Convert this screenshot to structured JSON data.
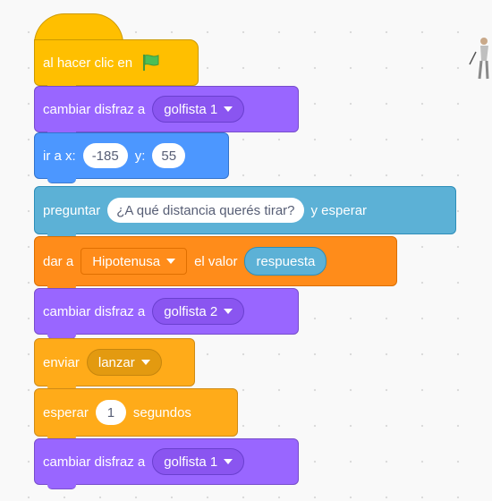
{
  "blocks": {
    "when_clicked": {
      "label": "al hacer clic en"
    },
    "switch_costume_1": {
      "label": "cambiar disfraz a",
      "value": "golfista 1"
    },
    "goto": {
      "label": "ir a x:",
      "x": "-185",
      "y_label": "y:",
      "y": "55"
    },
    "ask": {
      "label": "preguntar",
      "question": "¿A qué distancia querés tirar?",
      "suffix": "y esperar"
    },
    "set_var": {
      "label": "dar a",
      "variable": "Hipotenusa",
      "middle": "el valor",
      "reporter": "respuesta"
    },
    "switch_costume_2": {
      "label": "cambiar disfraz a",
      "value": "golfista 2"
    },
    "broadcast": {
      "label": "enviar",
      "value": "lanzar"
    },
    "wait": {
      "label": "esperar",
      "value": "1",
      "suffix": "segundos"
    },
    "switch_costume_3": {
      "label": "cambiar disfraz a",
      "value": "golfista 1"
    }
  },
  "icons": {
    "flag": "green-flag-icon",
    "sprite": "golfer-sprite-icon"
  },
  "colors": {
    "events": "#ffbf00",
    "looks": "#9966ff",
    "motion": "#4c97ff",
    "sensing": "#5cb1d6",
    "variables": "#ff8c1a",
    "control": "#ffab19"
  }
}
